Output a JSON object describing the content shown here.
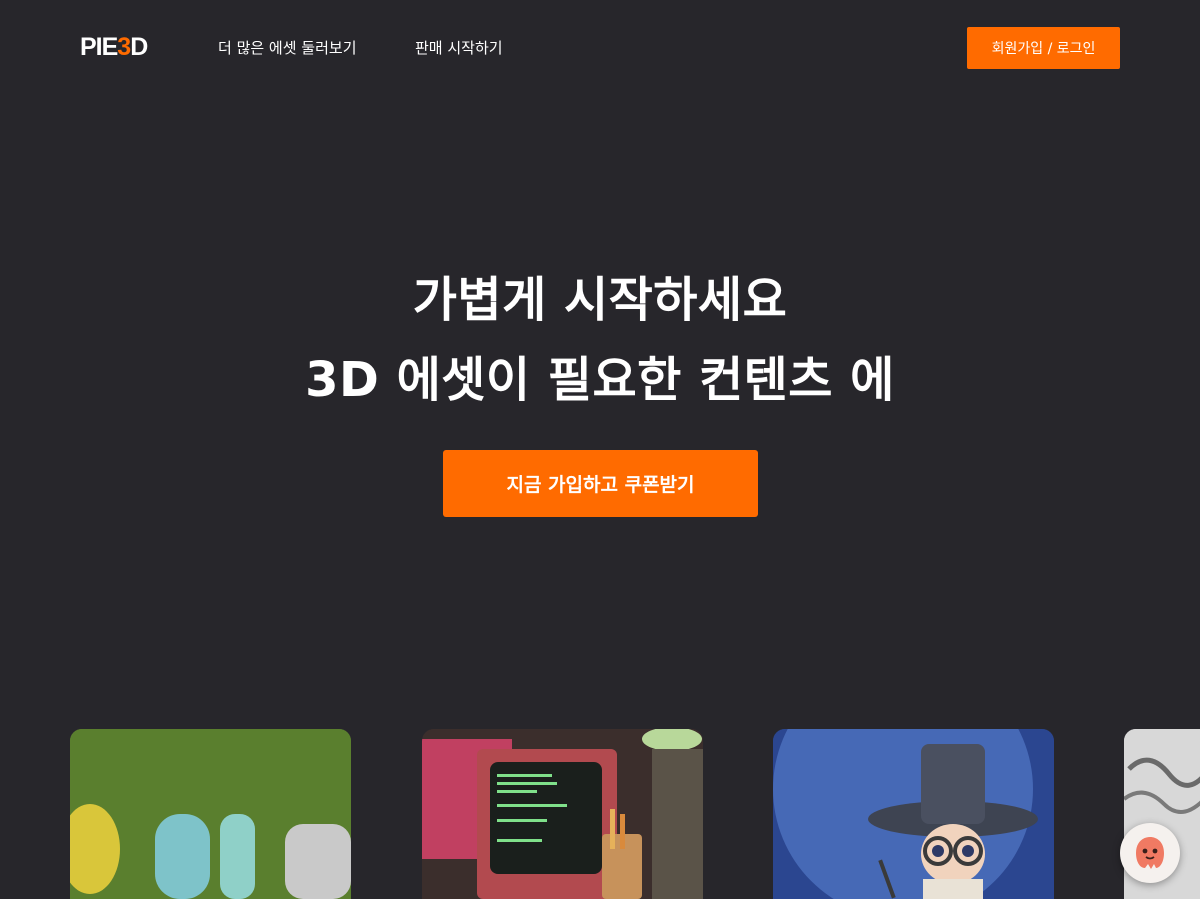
{
  "header": {
    "logo_left": "PIE",
    "logo_accent": "3",
    "logo_right": "D",
    "nav": [
      "더 많은 에셋 둘러보기",
      "판매 시작하기"
    ],
    "login_label": "회원가입 / 로그인"
  },
  "hero": {
    "line1": "가볍게 시작하세요",
    "line2": "3D 에셋이 필요한 컨텐츠 에",
    "cta_label": "지금 가입하고 쿠폰받기"
  },
  "colors": {
    "background": "#27262b",
    "accent": "#ff6b00"
  },
  "icons": {
    "chat": "chat-character-icon"
  }
}
